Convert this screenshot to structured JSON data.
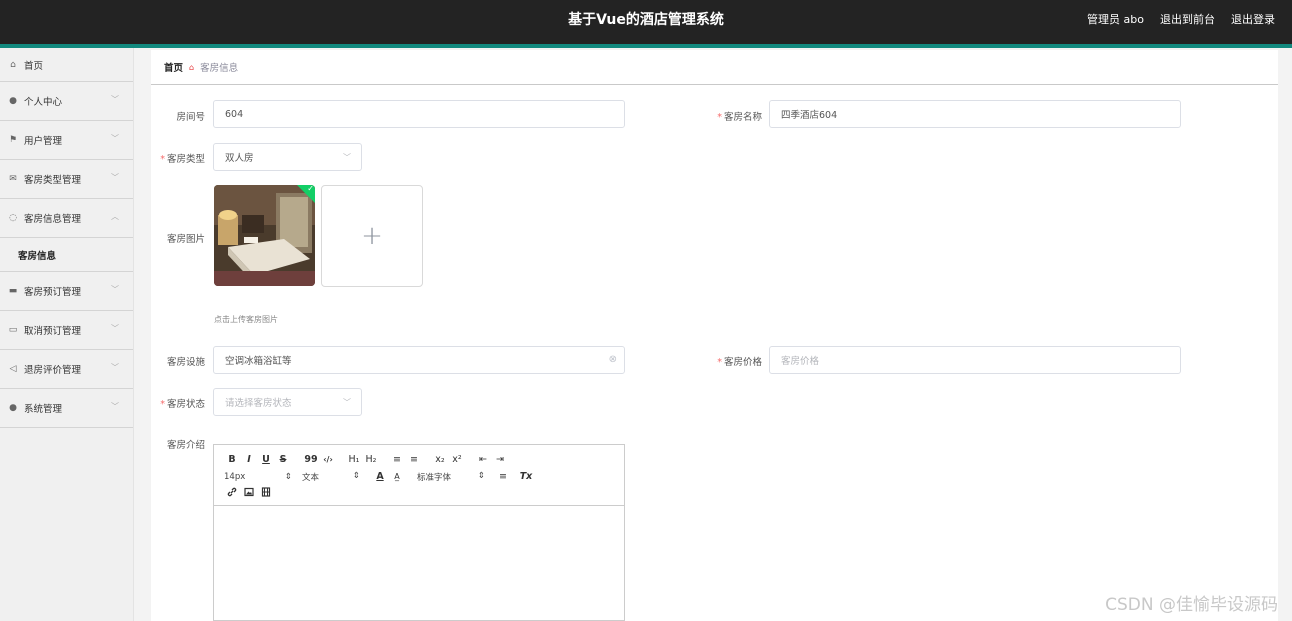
{
  "header": {
    "title": "基于Vue的酒店管理系统",
    "user_label": "管理员 abo",
    "front_link": "退出到前台",
    "logout_link": "退出登录"
  },
  "sidebar": {
    "items": [
      {
        "label": "首页",
        "icon": "home-icon"
      },
      {
        "label": "个人中心",
        "icon": "user-icon"
      },
      {
        "label": "用户管理",
        "icon": "flag-icon"
      },
      {
        "label": "客房类型管理",
        "icon": "mail-icon"
      },
      {
        "label": "客房信息管理",
        "icon": "power-icon"
      },
      {
        "label": "客房信息",
        "icon": ""
      },
      {
        "label": "客房预订管理",
        "icon": "ticket-icon"
      },
      {
        "label": "取消预订管理",
        "icon": "chat-icon"
      },
      {
        "label": "退房评价管理",
        "icon": "send-icon"
      },
      {
        "label": "系统管理",
        "icon": "user-icon"
      }
    ]
  },
  "breadcrumb": {
    "home": "首页",
    "current": "客房信息"
  },
  "form": {
    "room_no_label": "房间号",
    "room_no_value": "604",
    "room_name_label": "客房名称",
    "room_name_value": "四季酒店604",
    "room_type_label": "客房类型",
    "room_type_value": "双人房",
    "room_image_label": "客房图片",
    "upload_tip": "点击上传客房图片",
    "facilities_label": "客房设施",
    "facilities_value": "空调冰箱浴缸等",
    "price_label": "客房价格",
    "price_placeholder": "客房价格",
    "status_label": "客房状态",
    "status_placeholder": "请选择客房状态",
    "intro_label": "客房介绍"
  },
  "editor": {
    "row1": [
      "B",
      "I",
      "U",
      "S",
      "99",
      "‹/›",
      "H₁",
      "H₂",
      "≡",
      "≡",
      "x₂",
      "x²",
      "⇤",
      "⇥"
    ],
    "font_size": "14px",
    "text_style": "文本",
    "font_family": "标准字体",
    "row2_icons": [
      "A",
      "A̲",
      "≡",
      "Tx"
    ],
    "row3": [
      "link-icon",
      "image-icon",
      "video-icon"
    ]
  },
  "watermark": "CSDN @佳愉毕设源码"
}
